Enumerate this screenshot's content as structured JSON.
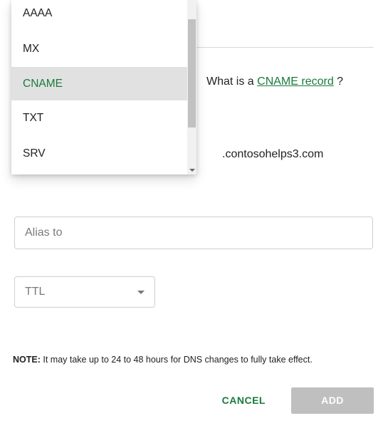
{
  "dropdown": {
    "items": [
      {
        "label": "AAAA",
        "selected": false
      },
      {
        "label": "MX",
        "selected": false
      },
      {
        "label": "CNAME",
        "selected": true
      },
      {
        "label": "TXT",
        "selected": false
      },
      {
        "label": "SRV",
        "selected": false
      }
    ]
  },
  "info": {
    "what_prefix": "What is a ",
    "what_link": "CNAME record",
    "what_suffix": " ?"
  },
  "host": {
    "suffix": ".contosohelps3.com"
  },
  "alias": {
    "placeholder": "Alias to",
    "value": ""
  },
  "ttl": {
    "placeholder": "TTL"
  },
  "note": {
    "label": "NOTE:",
    "text": " It may take up to 24 to 48 hours for DNS changes to fully take effect."
  },
  "buttons": {
    "cancel": "CANCEL",
    "add": "ADD"
  }
}
